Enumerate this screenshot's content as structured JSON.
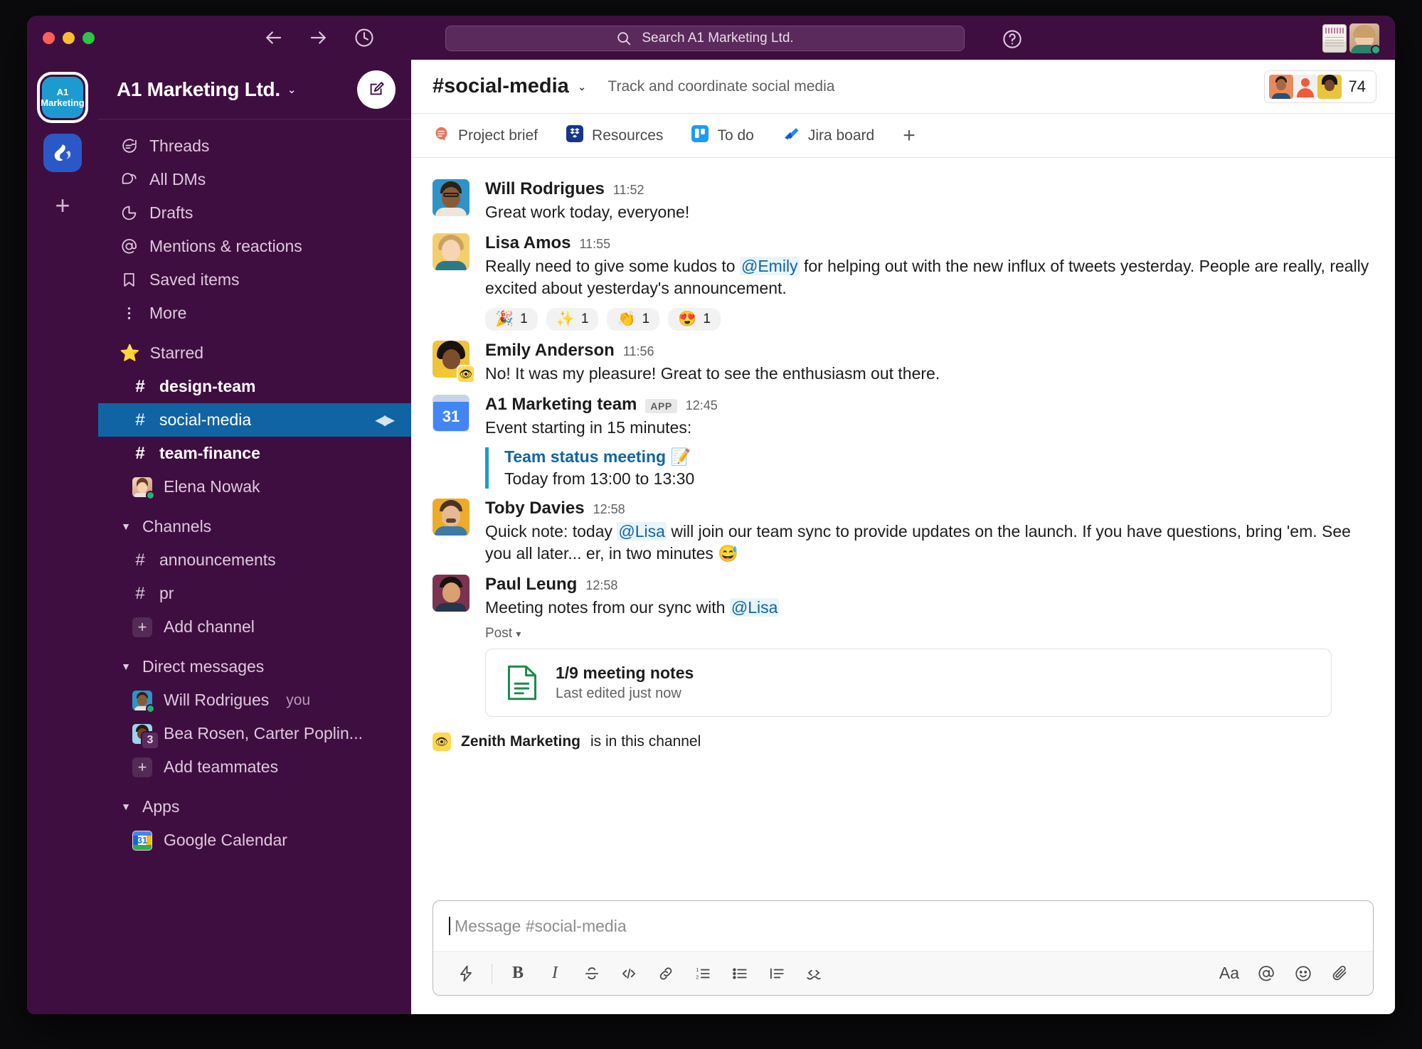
{
  "window": {
    "traffic_lights": [
      "close",
      "minimize",
      "maximize"
    ],
    "nav": {
      "back": "back-arrow",
      "forward": "forward-arrow",
      "history": "clock"
    }
  },
  "search": {
    "placeholder": "Search A1 Marketing Ltd.",
    "icon": "search-icon"
  },
  "help": {
    "label": "?"
  },
  "rail": {
    "workspace_badge": "A1 Marketing",
    "second_workspace": "workspace-icon",
    "add_workspace": "+"
  },
  "sidebar": {
    "workspace_name": "A1 Marketing Ltd.",
    "workspace_caret": "⌄",
    "compose": "compose-button",
    "nav_items": [
      {
        "label": "Threads",
        "icon": "threads-icon"
      },
      {
        "label": "All DMs",
        "icon": "dms-icon"
      },
      {
        "label": "Drafts",
        "icon": "drafts-icon"
      },
      {
        "label": "Mentions & reactions",
        "icon": "at-icon"
      },
      {
        "label": "Saved items",
        "icon": "bookmark-icon"
      },
      {
        "label": "More",
        "icon": "more-icon"
      }
    ],
    "starred": {
      "label": "Starred",
      "icon": "star-icon"
    },
    "starred_items": [
      {
        "label": "design-team",
        "type": "channel",
        "state": "unread"
      },
      {
        "label": "social-media",
        "type": "channel",
        "state": "active"
      },
      {
        "label": "team-finance",
        "type": "channel",
        "state": "unread"
      },
      {
        "label": "Elena Nowak",
        "type": "dm",
        "presence": "active"
      }
    ],
    "channels_section": {
      "label": "Channels",
      "expanded": true
    },
    "channels": [
      {
        "label": "announcements",
        "type": "channel"
      },
      {
        "label": "pr",
        "type": "channel"
      },
      {
        "label": "Add channel",
        "type": "add"
      }
    ],
    "dm_section": {
      "label": "Direct messages",
      "expanded": true
    },
    "dms": [
      {
        "label": "Will Rodrigues",
        "suffix": "you",
        "type": "dm",
        "presence": "active"
      },
      {
        "label": "Bea Rosen, Carter Poplin...",
        "type": "group",
        "count": "3"
      },
      {
        "label": "Add teammates",
        "type": "add"
      }
    ],
    "apps_section": {
      "label": "Apps",
      "expanded": true
    },
    "apps": [
      {
        "label": "Google Calendar",
        "icon": "google-calendar-icon",
        "day": "31"
      }
    ]
  },
  "channel": {
    "title": "#social-media",
    "caret": "⌄",
    "topic": "Track and coordinate social media",
    "member_count": "74"
  },
  "tabs": [
    {
      "label": "Project brief",
      "icon": "post-icon"
    },
    {
      "label": "Resources",
      "icon": "dropbox-icon"
    },
    {
      "label": "To do",
      "icon": "trello-icon"
    },
    {
      "label": "Jira board",
      "icon": "jira-icon"
    }
  ],
  "tab_add": "+",
  "messages": [
    {
      "author": "Will Rodrigues",
      "time": "11:52",
      "text": "Great work today, everyone!"
    },
    {
      "author": "Lisa Amos",
      "time": "11:55",
      "text_parts": [
        {
          "t": "Really need to give some kudos to "
        },
        {
          "t": "@Emily",
          "mention": true
        },
        {
          "t": " for helping out with the new influx of tweets yesterday. People are really, really excited about yesterday's announcement."
        }
      ],
      "reactions": [
        {
          "emoji": "🎉",
          "count": "1"
        },
        {
          "emoji": "✨",
          "count": "1"
        },
        {
          "emoji": "👏",
          "count": "1"
        },
        {
          "emoji": "😍",
          "count": "1"
        }
      ]
    },
    {
      "author": "Emily Anderson",
      "time": "11:56",
      "status_emoji": "👁",
      "text": "No! It was my pleasure! Great to see the enthusiasm out there."
    },
    {
      "author": "A1 Marketing team",
      "badge": "APP",
      "time": "12:45",
      "text": "Event starting in 15 minutes:",
      "event": {
        "title": "Team status meeting 📝",
        "when": "Today from 13:00 to 13:30"
      }
    },
    {
      "author": "Toby Davies",
      "time": "12:58",
      "text_parts": [
        {
          "t": "Quick note: today "
        },
        {
          "t": "@Lisa",
          "mention": true
        },
        {
          "t": " will join our team sync to provide updates on the launch. If you have questions, bring 'em. See you all later... er, in two minutes 😅"
        }
      ]
    },
    {
      "author": "Paul Leung",
      "time": "12:58",
      "text_parts": [
        {
          "t": "Meeting notes from our sync with "
        },
        {
          "t": "@Lisa",
          "mention": true
        }
      ],
      "post_label": "Post",
      "post_card": {
        "title": "1/9 meeting notes",
        "subtitle": "Last edited just now"
      }
    }
  ],
  "channel_notice": {
    "app": "Zenith Marketing",
    "rest": " is in this channel"
  },
  "composer": {
    "placeholder": "Message #social-media",
    "toolbar_left": [
      {
        "name": "shortcuts-icon",
        "glyph": "⚡"
      },
      {
        "name": "bold-icon",
        "glyph": "B"
      },
      {
        "name": "italic-icon",
        "glyph": "I"
      },
      {
        "name": "strikethrough-icon",
        "glyph": "S"
      },
      {
        "name": "code-icon",
        "glyph": "</>"
      },
      {
        "name": "link-icon",
        "glyph": "🔗"
      },
      {
        "name": "ordered-list-icon",
        "glyph": "1."
      },
      {
        "name": "bulleted-list-icon",
        "glyph": "•"
      },
      {
        "name": "blockquote-icon",
        "glyph": "❙≡"
      },
      {
        "name": "code-block-icon",
        "glyph": "⌨"
      }
    ],
    "toolbar_right": [
      {
        "name": "formatting-icon",
        "glyph": "Aa"
      },
      {
        "name": "mention-icon",
        "glyph": "@"
      },
      {
        "name": "emoji-icon",
        "glyph": "☺"
      },
      {
        "name": "attachment-icon",
        "glyph": "📎"
      }
    ]
  },
  "colors": {
    "sidebar_bg": "#3f0e40",
    "active_channel": "#1164a3",
    "mention_text": "#1264a3",
    "link_blue": "#1264a3",
    "presence_green": "#2bac76"
  }
}
